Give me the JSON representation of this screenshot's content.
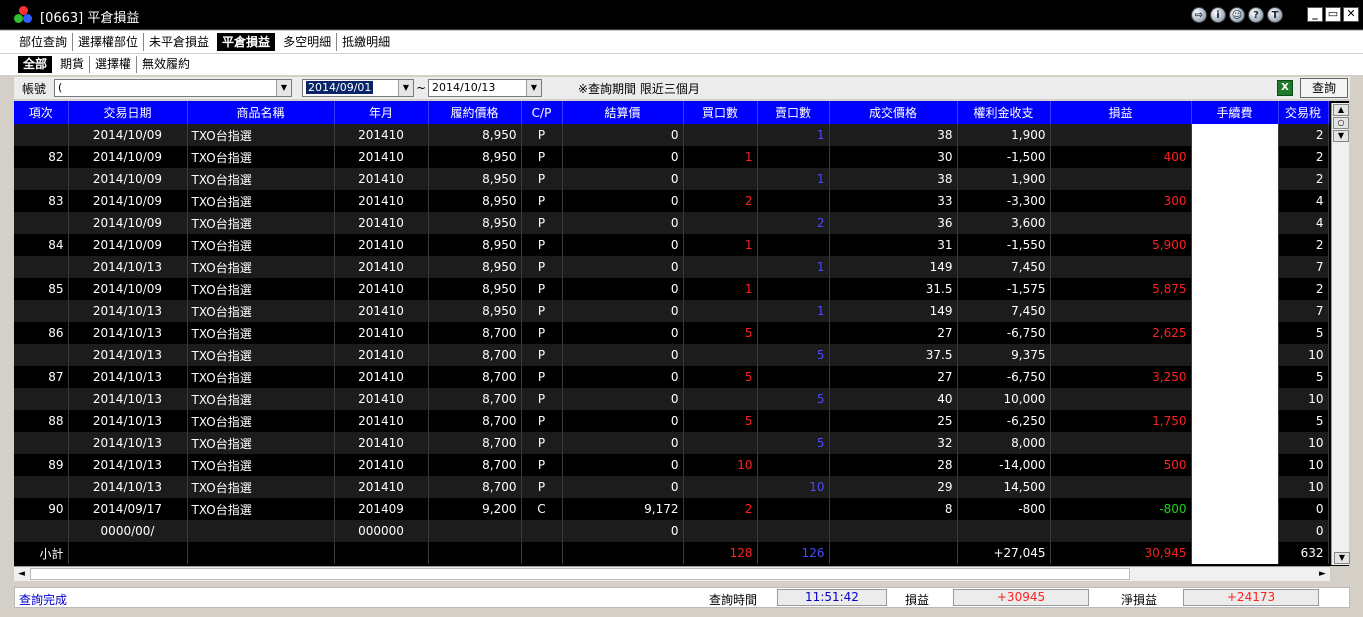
{
  "window": {
    "title": "[0663] 平倉損益",
    "tool_glyphs": [
      "⇨",
      "i",
      "☺",
      "?",
      "T"
    ],
    "win_glyphs": [
      "_",
      "▭",
      "✕"
    ]
  },
  "menu_tabs": [
    "部位查詢",
    "選擇權部位",
    "未平倉損益",
    "平倉損益",
    "多空明細",
    "抵繳明細"
  ],
  "menu_active": 3,
  "sub_tabs": [
    "全部",
    "期貨",
    "選擇權",
    "無效履約"
  ],
  "sub_active": 0,
  "filter": {
    "account_label": "帳號",
    "account_value": "(",
    "date_from": "2014/09/01",
    "tilde": "~",
    "date_to": "2014/10/13",
    "note": "※查詢期間 限近三個月",
    "excel_glyph": "X",
    "query_button": "查詢"
  },
  "colors": {
    "header_bg": "#0000ff",
    "red": "#ff2020",
    "blue": "#4a4aff",
    "green": "#20d020"
  },
  "columns": [
    "項次",
    "交易日期",
    "商品名稱",
    "年月",
    "履約價格",
    "C/P",
    "結算價",
    "買口數",
    "賣口數",
    "成交價格",
    "權利金收支",
    "損益",
    "手續費",
    "交易稅"
  ],
  "rows": [
    {
      "no": "",
      "date": "2014/10/09",
      "name": "TXO台指選",
      "ym": "201410",
      "strike": "8,950",
      "cp": "P",
      "settle": "0",
      "buy": "",
      "sell": "1",
      "price": "38",
      "premium": "1,900",
      "pnl": "",
      "pnl_color": "",
      "tax": "2"
    },
    {
      "no": "82",
      "date": "2014/10/09",
      "name": "TXO台指選",
      "ym": "201410",
      "strike": "8,950",
      "cp": "P",
      "settle": "0",
      "buy": "1",
      "sell": "",
      "price": "30",
      "premium": "-1,500",
      "pnl": "400",
      "pnl_color": "red",
      "tax": "2"
    },
    {
      "no": "",
      "date": "2014/10/09",
      "name": "TXO台指選",
      "ym": "201410",
      "strike": "8,950",
      "cp": "P",
      "settle": "0",
      "buy": "",
      "sell": "1",
      "price": "38",
      "premium": "1,900",
      "pnl": "",
      "pnl_color": "",
      "tax": "2"
    },
    {
      "no": "83",
      "date": "2014/10/09",
      "name": "TXO台指選",
      "ym": "201410",
      "strike": "8,950",
      "cp": "P",
      "settle": "0",
      "buy": "2",
      "sell": "",
      "price": "33",
      "premium": "-3,300",
      "pnl": "300",
      "pnl_color": "red",
      "tax": "4"
    },
    {
      "no": "",
      "date": "2014/10/09",
      "name": "TXO台指選",
      "ym": "201410",
      "strike": "8,950",
      "cp": "P",
      "settle": "0",
      "buy": "",
      "sell": "2",
      "price": "36",
      "premium": "3,600",
      "pnl": "",
      "pnl_color": "",
      "tax": "4"
    },
    {
      "no": "84",
      "date": "2014/10/09",
      "name": "TXO台指選",
      "ym": "201410",
      "strike": "8,950",
      "cp": "P",
      "settle": "0",
      "buy": "1",
      "sell": "",
      "price": "31",
      "premium": "-1,550",
      "pnl": "5,900",
      "pnl_color": "red",
      "tax": "2"
    },
    {
      "no": "",
      "date": "2014/10/13",
      "name": "TXO台指選",
      "ym": "201410",
      "strike": "8,950",
      "cp": "P",
      "settle": "0",
      "buy": "",
      "sell": "1",
      "price": "149",
      "premium": "7,450",
      "pnl": "",
      "pnl_color": "",
      "tax": "7"
    },
    {
      "no": "85",
      "date": "2014/10/09",
      "name": "TXO台指選",
      "ym": "201410",
      "strike": "8,950",
      "cp": "P",
      "settle": "0",
      "buy": "1",
      "sell": "",
      "price": "31.5",
      "premium": "-1,575",
      "pnl": "5,875",
      "pnl_color": "red",
      "tax": "2"
    },
    {
      "no": "",
      "date": "2014/10/13",
      "name": "TXO台指選",
      "ym": "201410",
      "strike": "8,950",
      "cp": "P",
      "settle": "0",
      "buy": "",
      "sell": "1",
      "price": "149",
      "premium": "7,450",
      "pnl": "",
      "pnl_color": "",
      "tax": "7"
    },
    {
      "no": "86",
      "date": "2014/10/13",
      "name": "TXO台指選",
      "ym": "201410",
      "strike": "8,700",
      "cp": "P",
      "settle": "0",
      "buy": "5",
      "sell": "",
      "price": "27",
      "premium": "-6,750",
      "pnl": "2,625",
      "pnl_color": "red",
      "tax": "5"
    },
    {
      "no": "",
      "date": "2014/10/13",
      "name": "TXO台指選",
      "ym": "201410",
      "strike": "8,700",
      "cp": "P",
      "settle": "0",
      "buy": "",
      "sell": "5",
      "price": "37.5",
      "premium": "9,375",
      "pnl": "",
      "pnl_color": "",
      "tax": "10"
    },
    {
      "no": "87",
      "date": "2014/10/13",
      "name": "TXO台指選",
      "ym": "201410",
      "strike": "8,700",
      "cp": "P",
      "settle": "0",
      "buy": "5",
      "sell": "",
      "price": "27",
      "premium": "-6,750",
      "pnl": "3,250",
      "pnl_color": "red",
      "tax": "5"
    },
    {
      "no": "",
      "date": "2014/10/13",
      "name": "TXO台指選",
      "ym": "201410",
      "strike": "8,700",
      "cp": "P",
      "settle": "0",
      "buy": "",
      "sell": "5",
      "price": "40",
      "premium": "10,000",
      "pnl": "",
      "pnl_color": "",
      "tax": "10"
    },
    {
      "no": "88",
      "date": "2014/10/13",
      "name": "TXO台指選",
      "ym": "201410",
      "strike": "8,700",
      "cp": "P",
      "settle": "0",
      "buy": "5",
      "sell": "",
      "price": "25",
      "premium": "-6,250",
      "pnl": "1,750",
      "pnl_color": "red",
      "tax": "5"
    },
    {
      "no": "",
      "date": "2014/10/13",
      "name": "TXO台指選",
      "ym": "201410",
      "strike": "8,700",
      "cp": "P",
      "settle": "0",
      "buy": "",
      "sell": "5",
      "price": "32",
      "premium": "8,000",
      "pnl": "",
      "pnl_color": "",
      "tax": "10"
    },
    {
      "no": "89",
      "date": "2014/10/13",
      "name": "TXO台指選",
      "ym": "201410",
      "strike": "8,700",
      "cp": "P",
      "settle": "0",
      "buy": "10",
      "sell": "",
      "price": "28",
      "premium": "-14,000",
      "pnl": "500",
      "pnl_color": "red",
      "tax": "10"
    },
    {
      "no": "",
      "date": "2014/10/13",
      "name": "TXO台指選",
      "ym": "201410",
      "strike": "8,700",
      "cp": "P",
      "settle": "0",
      "buy": "",
      "sell": "10",
      "price": "29",
      "premium": "14,500",
      "pnl": "",
      "pnl_color": "",
      "tax": "10"
    },
    {
      "no": "90",
      "date": "2014/09/17",
      "name": "TXO台指選",
      "ym": "201409",
      "strike": "9,200",
      "cp": "C",
      "settle": "9,172",
      "buy": "2",
      "sell": "",
      "price": "8",
      "premium": "-800",
      "pnl": "-800",
      "pnl_color": "green",
      "tax": "0"
    },
    {
      "no": "",
      "date": "0000/00/",
      "name": "",
      "ym": "000000",
      "strike": "",
      "cp": "",
      "settle": "0",
      "buy": "",
      "sell": "",
      "price": "",
      "premium": "",
      "pnl": "",
      "pnl_color": "",
      "tax": "0"
    },
    {
      "no": "小計",
      "date": "",
      "name": "",
      "ym": "",
      "strike": "",
      "cp": "",
      "settle": "",
      "buy": "128",
      "sell": "126",
      "price": "",
      "premium": "+27,045",
      "pnl": "30,945",
      "pnl_color": "red",
      "tax": "632"
    }
  ],
  "scroll_glyphs": {
    "up": "▲",
    "mid": "○",
    "down": "▼",
    "left": "◄",
    "right": "►"
  },
  "status": {
    "message": "查詢完成",
    "query_time_label": "查詢時間",
    "query_time": "11:51:42",
    "pnl_label": "損益",
    "pnl_value": "+30945",
    "net_pnl_label": "淨損益",
    "net_pnl_value": "+24173"
  }
}
